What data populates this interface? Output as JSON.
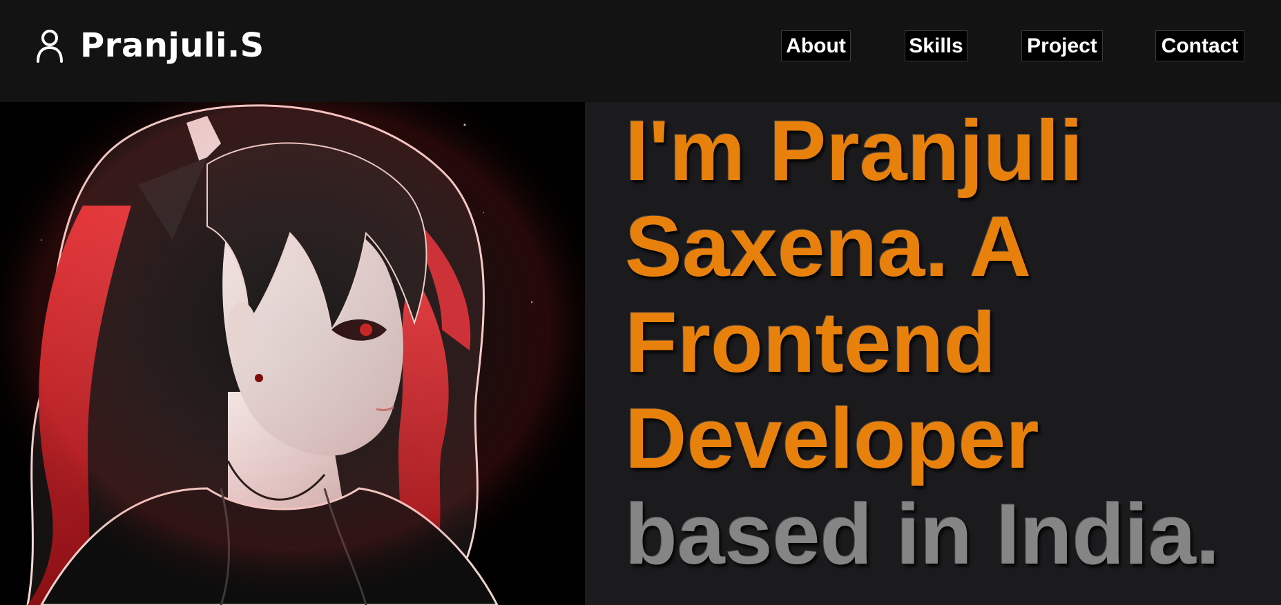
{
  "brand": {
    "name": "Pranjuli.S",
    "icon": "user-icon"
  },
  "nav": {
    "items": [
      {
        "label": "About"
      },
      {
        "label": "Skills"
      },
      {
        "label": "Project"
      },
      {
        "label": "Contact"
      }
    ]
  },
  "hero": {
    "image": "anime-girl-portrait",
    "lines": [
      "I'm Pranjuli",
      "Saxena. A",
      "Frontend",
      "Developer",
      "based in India."
    ]
  },
  "colors": {
    "accent": "#e8810c",
    "secondary_text": "#858585",
    "nav_background": "#131313",
    "page_background": "#1b1b1d"
  }
}
